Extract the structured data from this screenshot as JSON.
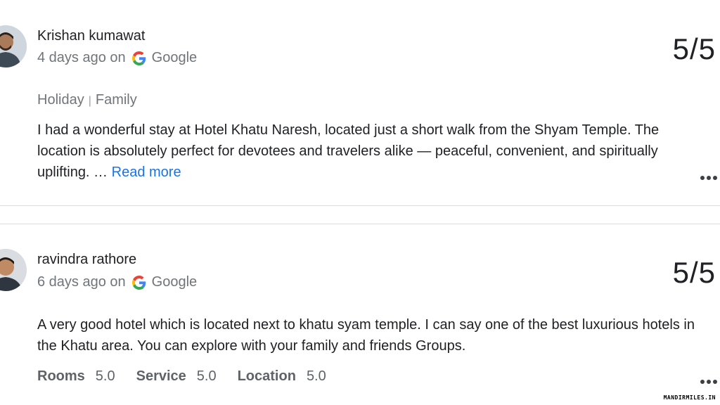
{
  "reviews": [
    {
      "author": "Krishan kumawat",
      "time": "4 days ago on",
      "source": "Google",
      "score": "5/5",
      "tags": [
        "Holiday",
        "Family"
      ],
      "text": "I had a wonderful stay at Hotel Khatu Naresh, located just a short walk from the Shyam Temple. The location is absolutely perfect for devotees and travelers alike — peaceful, convenient, and spiritually uplifting. …",
      "read_more": "Read more"
    },
    {
      "author": "ravindra rathore",
      "time": "6 days ago on",
      "source": "Google",
      "score": "5/5",
      "text": "A very good hotel which is located next to khatu syam temple. I can say one of the best luxurious hotels in the Khatu area. You can explore with your family and friends Groups.",
      "ratings": [
        {
          "label": "Rooms",
          "value": "5.0"
        },
        {
          "label": "Service",
          "value": "5.0"
        },
        {
          "label": "Location",
          "value": "5.0"
        }
      ]
    }
  ],
  "watermark": "MANDIRMILES.IN",
  "icons": {
    "source": "google-g-icon",
    "more": "more-horizontal-icon"
  },
  "colors": {
    "link": "#1a73e8",
    "muted": "#70757a",
    "text": "#202124"
  }
}
